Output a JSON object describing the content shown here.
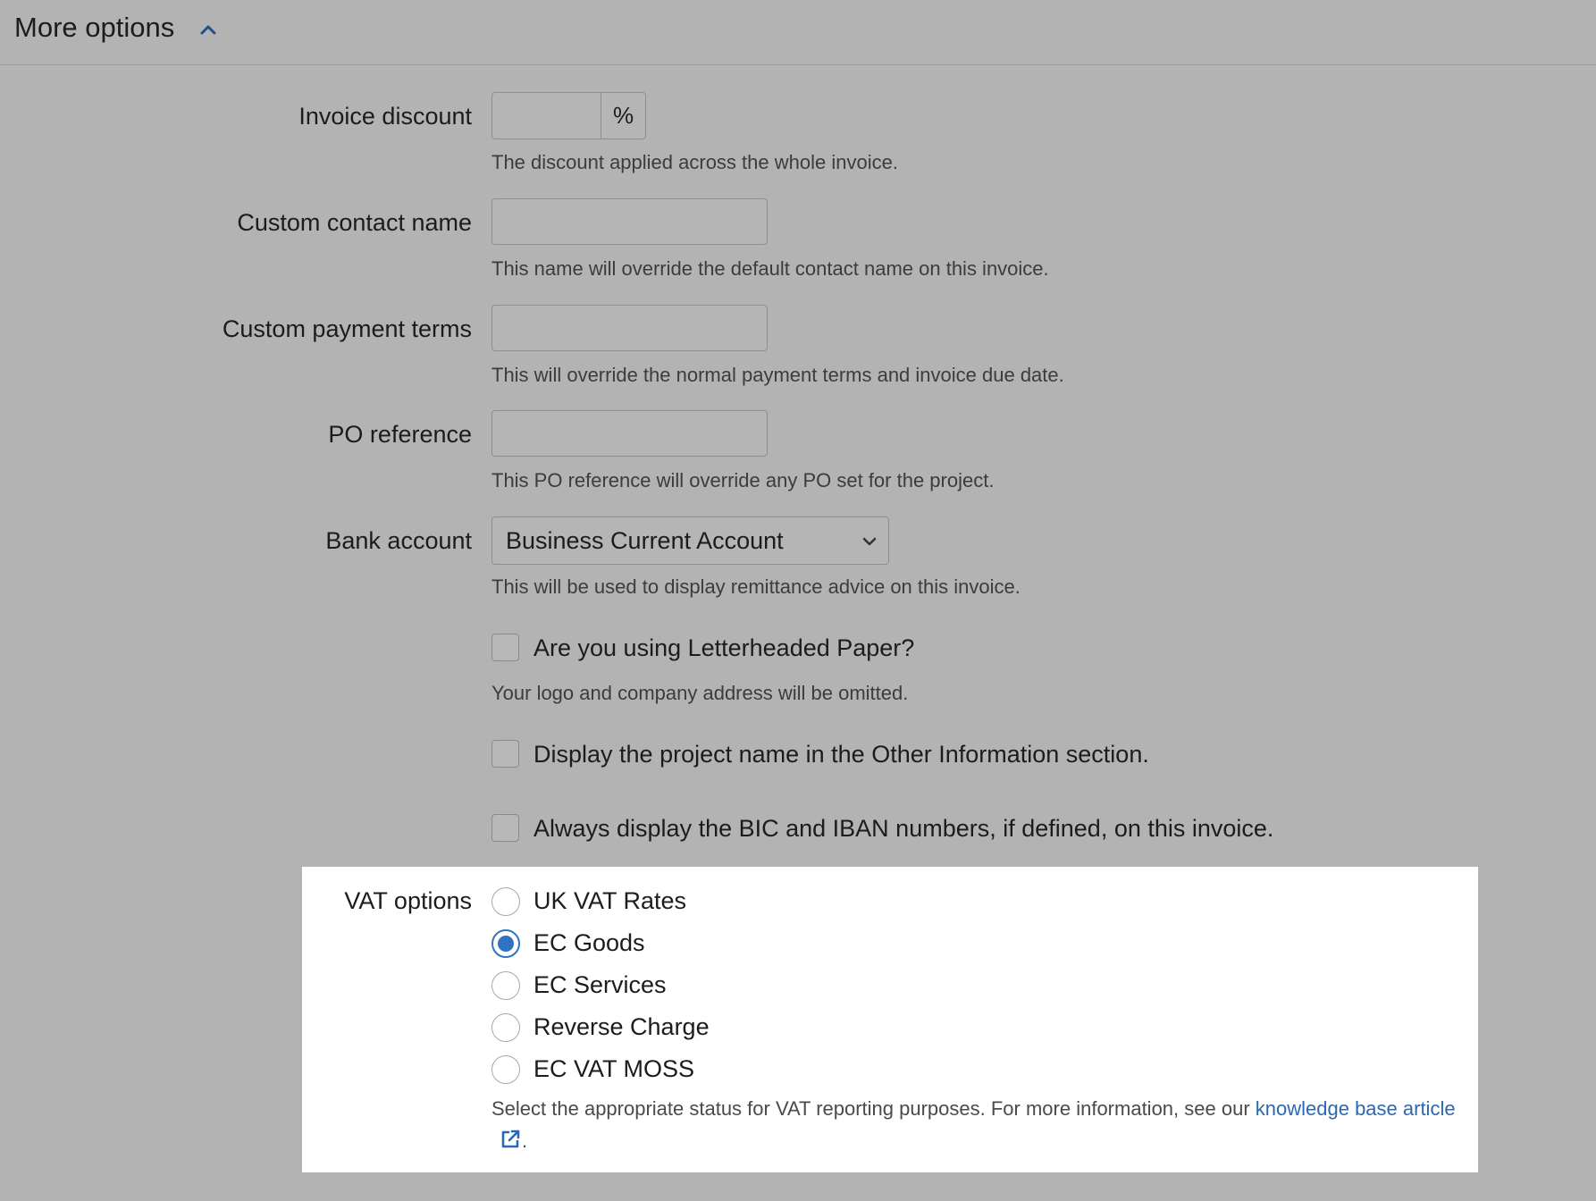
{
  "header": {
    "title": "More options"
  },
  "invoice_discount": {
    "label": "Invoice discount",
    "value": "",
    "suffix": "%",
    "help": "The discount applied across the whole invoice."
  },
  "custom_contact_name": {
    "label": "Custom contact name",
    "value": "",
    "help": "This name will override the default contact name on this invoice."
  },
  "custom_payment_terms": {
    "label": "Custom payment terms",
    "value": "",
    "help": "This will override the normal payment terms and invoice due date."
  },
  "po_reference": {
    "label": "PO reference",
    "value": "",
    "help": "This PO reference will override any PO set for the project."
  },
  "bank_account": {
    "label": "Bank account",
    "selected": "Business Current Account",
    "help": "This will be used to display remittance advice on this invoice."
  },
  "checkboxes": [
    {
      "label": "Are you using Letterheaded Paper?",
      "checked": false,
      "help": "Your logo and company address will be omitted."
    },
    {
      "label": "Display the project name in the Other Information section.",
      "checked": false
    },
    {
      "label": "Always display the BIC and IBAN numbers, if defined, on this invoice.",
      "checked": false
    }
  ],
  "vat_options": {
    "label": "VAT options",
    "options": [
      {
        "label": "UK VAT Rates",
        "checked": false
      },
      {
        "label": "EC Goods",
        "checked": true
      },
      {
        "label": "EC Services",
        "checked": false
      },
      {
        "label": "Reverse Charge",
        "checked": false
      },
      {
        "label": "EC VAT MOSS",
        "checked": false
      }
    ],
    "help_text": "Select the appropriate status for VAT reporting purposes. For more information, see our ",
    "link_text": "knowledge base article",
    "help_end": "."
  },
  "colors": {
    "accent": "#2f74c0",
    "link": "#2a68b3",
    "overlay_background": "#b3b3b3",
    "panel_background": "#ffffff"
  },
  "icons": {
    "header_toggle": "chevron-up-icon",
    "select_caret": "chevron-down-icon",
    "link_icon": "external-link-icon"
  }
}
